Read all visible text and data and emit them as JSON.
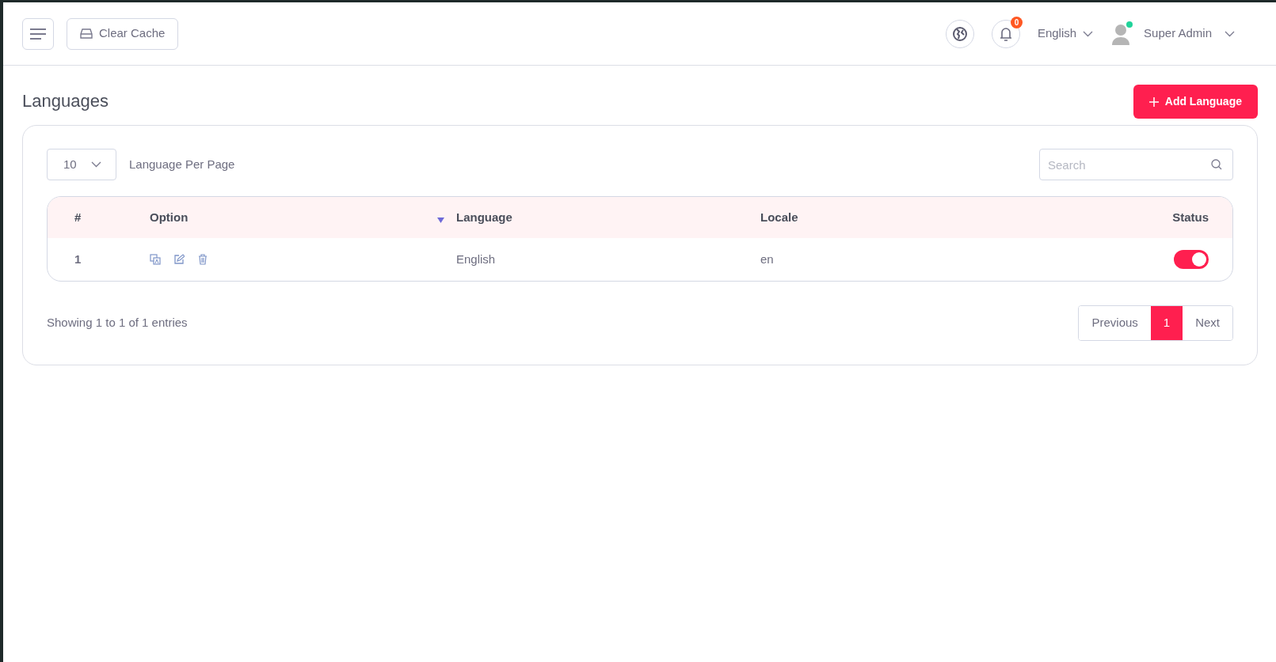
{
  "header": {
    "clear_cache": "Clear Cache",
    "notification_count": "0",
    "language": "English",
    "user": {
      "name": "Super Admin",
      "online": true
    }
  },
  "page": {
    "title": "Languages",
    "add_button": "Add Language"
  },
  "table_controls": {
    "per_page": "10",
    "per_page_label": "Language Per Page",
    "search": {
      "placeholder": "Search"
    }
  },
  "table": {
    "columns": [
      "#",
      "Option",
      "Language",
      "Locale",
      "Status"
    ],
    "rows": [
      {
        "number": "1",
        "language": "English",
        "locale": "en",
        "status_on": true
      }
    ]
  },
  "footer": {
    "summary": "Showing 1 to 1 of 1 entries",
    "pagination": [
      {
        "label": "Previous",
        "selected": false
      },
      {
        "label": "1",
        "selected": true
      },
      {
        "label": "Next",
        "selected": false
      }
    ]
  }
}
